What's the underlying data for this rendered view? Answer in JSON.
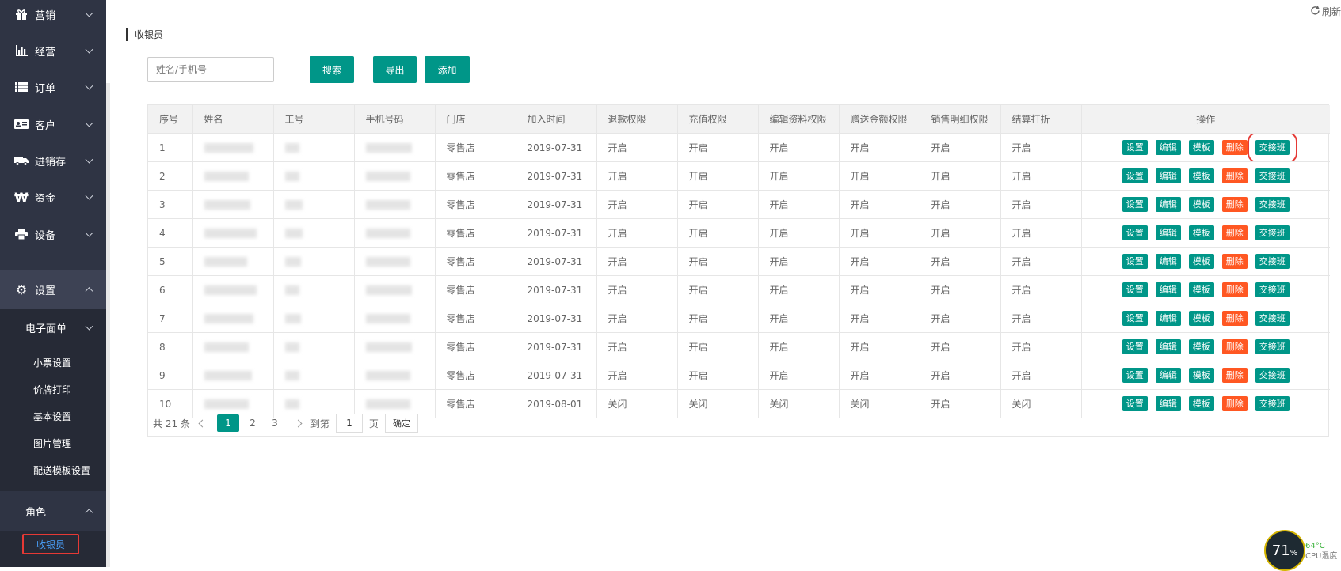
{
  "sidebar": {
    "items": [
      {
        "label": "营销",
        "icon": "gift-icon"
      },
      {
        "label": "经营",
        "icon": "bar-chart-icon"
      },
      {
        "label": "订单",
        "icon": "list-icon"
      },
      {
        "label": "客户",
        "icon": "id-card-icon"
      },
      {
        "label": "进销存",
        "icon": "truck-icon"
      },
      {
        "label": "资金",
        "icon": "won-icon"
      },
      {
        "label": "设备",
        "icon": "printer-icon"
      },
      {
        "label": "设置",
        "icon": "gear-icon"
      }
    ],
    "sub_group": "电子面单",
    "sub_items": [
      "小票设置",
      "价牌打印",
      "基本设置",
      "图片管理",
      "配送模板设置"
    ],
    "role_group": "角色",
    "active_item": "收银员"
  },
  "header": {
    "refresh_label": "刷新"
  },
  "breadcrumb": "收银员",
  "toolbar": {
    "search_placeholder": "姓名/手机号",
    "search_label": "搜索",
    "export_label": "导出",
    "add_label": "添加"
  },
  "table": {
    "headers": [
      "序号",
      "姓名",
      "工号",
      "手机号码",
      "门店",
      "加入时间",
      "退款权限",
      "充值权限",
      "编辑资料权限",
      "赠送金额权限",
      "销售明细权限",
      "结算打折",
      "操作"
    ],
    "rows": [
      {
        "no": "1",
        "store": "零售店",
        "joined": "2019-07-31",
        "p": [
          "开启",
          "开启",
          "开启",
          "开启",
          "开启",
          "开启"
        ]
      },
      {
        "no": "2",
        "store": "零售店",
        "joined": "2019-07-31",
        "p": [
          "开启",
          "开启",
          "开启",
          "开启",
          "开启",
          "开启"
        ]
      },
      {
        "no": "3",
        "store": "零售店",
        "joined": "2019-07-31",
        "p": [
          "开启",
          "开启",
          "开启",
          "开启",
          "开启",
          "开启"
        ]
      },
      {
        "no": "4",
        "store": "零售店",
        "joined": "2019-07-31",
        "p": [
          "开启",
          "开启",
          "开启",
          "开启",
          "开启",
          "开启"
        ]
      },
      {
        "no": "5",
        "store": "零售店",
        "joined": "2019-07-31",
        "p": [
          "开启",
          "开启",
          "开启",
          "开启",
          "开启",
          "开启"
        ]
      },
      {
        "no": "6",
        "store": "零售店",
        "joined": "2019-07-31",
        "p": [
          "开启",
          "开启",
          "开启",
          "开启",
          "开启",
          "开启"
        ]
      },
      {
        "no": "7",
        "store": "零售店",
        "joined": "2019-07-31",
        "p": [
          "开启",
          "开启",
          "开启",
          "开启",
          "开启",
          "开启"
        ]
      },
      {
        "no": "8",
        "store": "零售店",
        "joined": "2019-07-31",
        "p": [
          "开启",
          "开启",
          "开启",
          "开启",
          "开启",
          "开启"
        ]
      },
      {
        "no": "9",
        "store": "零售店",
        "joined": "2019-07-31",
        "p": [
          "开启",
          "开启",
          "开启",
          "开启",
          "开启",
          "开启"
        ]
      },
      {
        "no": "10",
        "store": "零售店",
        "joined": "2019-08-01",
        "p": [
          "关闭",
          "关闭",
          "关闭",
          "关闭",
          "开启",
          "关闭"
        ]
      }
    ],
    "actions": [
      "设置",
      "编辑",
      "模板",
      "删除",
      "交接班"
    ]
  },
  "pager": {
    "total": "共 21 条",
    "pages": [
      "1",
      "2",
      "3"
    ],
    "current": "1",
    "goto_label": "到第",
    "goto_value": "1",
    "page_unit": "页",
    "confirm_label": "确定"
  },
  "cpu_widget": {
    "usage": "71",
    "unit": "%",
    "temp": "64°C",
    "label": "CPU温度"
  },
  "colors": {
    "sidebar": "#2f3444",
    "accent": "#009688",
    "danger": "#ff5722",
    "highlight": "#e53935"
  }
}
